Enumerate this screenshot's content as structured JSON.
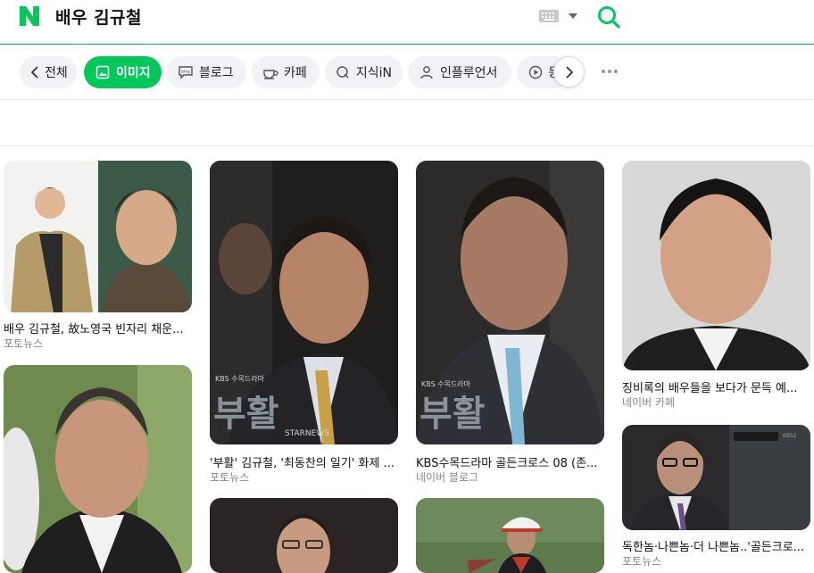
{
  "header": {
    "query": "배우 김규철",
    "logo_letter": "N",
    "brand_color": "#03c75a"
  },
  "tabs": [
    {
      "label": "전체",
      "icon": "chevron-left-icon"
    },
    {
      "label": "이미지",
      "icon": "image-icon",
      "active": true
    },
    {
      "label": "블로그",
      "icon": "blog-icon"
    },
    {
      "label": "카페",
      "icon": "cafe-icon"
    },
    {
      "label": "지식iN",
      "icon": "kin-icon"
    },
    {
      "label": "인플루언서",
      "icon": "person-icon"
    },
    {
      "label": "동",
      "icon": "play-icon"
    }
  ],
  "results": [
    {
      "caption": "배우 김규철, 故노영국 빈자리 채운...",
      "source": "포토뉴스"
    },
    {
      "caption": "'부활' 김규철, '최동찬의 일기' 화제 ...",
      "source": "포토뉴스",
      "overlay": "부활",
      "overlay_small": "KBS 수목드라마",
      "overlay_brand": "STARNEWS"
    },
    {
      "caption": "KBS수목드라마 골든크로스 08 (존...",
      "source": "네이버 블로그",
      "overlay": "부활",
      "overlay_small": "KBS 수목드라마"
    },
    {
      "caption": "징비록의 배우들을 보다가 문득 예...",
      "source": "네이버 카페"
    },
    {
      "caption": "",
      "source": ""
    },
    {
      "caption": "독한놈·나쁜놈·더 나쁜놈..'골든크로...",
      "source": "포토뉴스",
      "overlay_small": "KBS2"
    },
    {
      "caption": "",
      "source": ""
    },
    {
      "caption": "",
      "source": ""
    }
  ]
}
